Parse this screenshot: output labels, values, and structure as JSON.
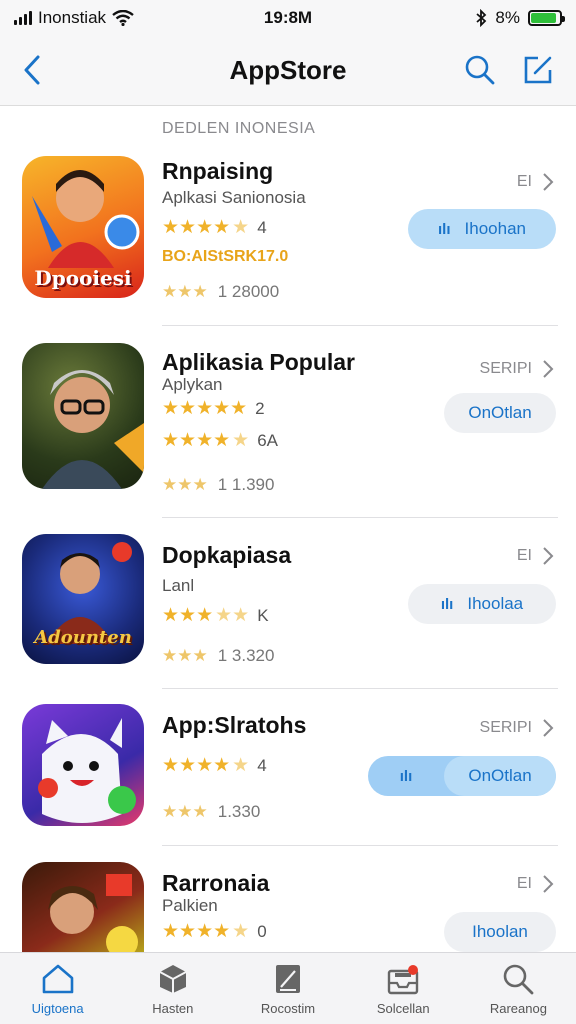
{
  "status": {
    "carrier": "Inonstiak",
    "time": "19:8M",
    "battery_text": "8%",
    "battery_level": 0.9
  },
  "nav": {
    "title": "AppStore"
  },
  "section": {
    "header": "DEDLEN INONESIA"
  },
  "apps": [
    {
      "name": "Rnpaising",
      "subtitle": "Aplkasi Sanionosia",
      "rating_count": "4",
      "price_line": "BO:AIStSRK17.0",
      "reviews": "1 28000",
      "price_label": "EI",
      "button": "Ihoohan",
      "icon_text": "Dpooiesi",
      "colors": {
        "icon_bg1": "#f5a623",
        "icon_bg2": "#e8321e"
      }
    },
    {
      "name": "Aplikasia Popular",
      "subtitle": "Aplykan",
      "rating_count": "2",
      "rating_count2": "6A",
      "reviews": "1 1.390",
      "price_label": "SERIPI",
      "button": "OnOtlan",
      "icon_text": "",
      "colors": {
        "icon_bg1": "#3a4a2a",
        "icon_bg2": "#d98a1a"
      }
    },
    {
      "name": "Dopkapiasa",
      "subtitle": "Lanl",
      "rating_count": "K",
      "reviews": "1 3.320",
      "price_label": "EI",
      "button": "Ihoolaa",
      "icon_text": "Adounten",
      "colors": {
        "icon_bg1": "#1a2a6a",
        "icon_bg2": "#3a5ad8"
      }
    },
    {
      "name": "App:Slratohs",
      "subtitle": "",
      "rating_count": "4",
      "reviews": "1.330",
      "price_label": "SERIPI",
      "button": "OnOtlan",
      "icon_text": "",
      "colors": {
        "icon_bg1": "#5a3ad8",
        "icon_bg2": "#e83a6a"
      }
    },
    {
      "name": "Rarronaia",
      "subtitle": "Palkien",
      "rating_count": "0",
      "price_label": "EI",
      "button": "Ihoolan",
      "colors": {
        "icon_bg1": "#6a2a1a",
        "icon_bg2": "#c8d81a"
      }
    }
  ],
  "tabs": [
    {
      "label": "Uigtoena",
      "icon": "home-icon",
      "active": true
    },
    {
      "label": "Hasten",
      "icon": "box-icon",
      "active": false
    },
    {
      "label": "Rocostim",
      "icon": "note-icon",
      "active": false
    },
    {
      "label": "Solcellan",
      "icon": "inbox-icon",
      "active": false
    },
    {
      "label": "Rareanog",
      "icon": "search-icon",
      "active": false
    }
  ],
  "accent": "#1a73c8"
}
